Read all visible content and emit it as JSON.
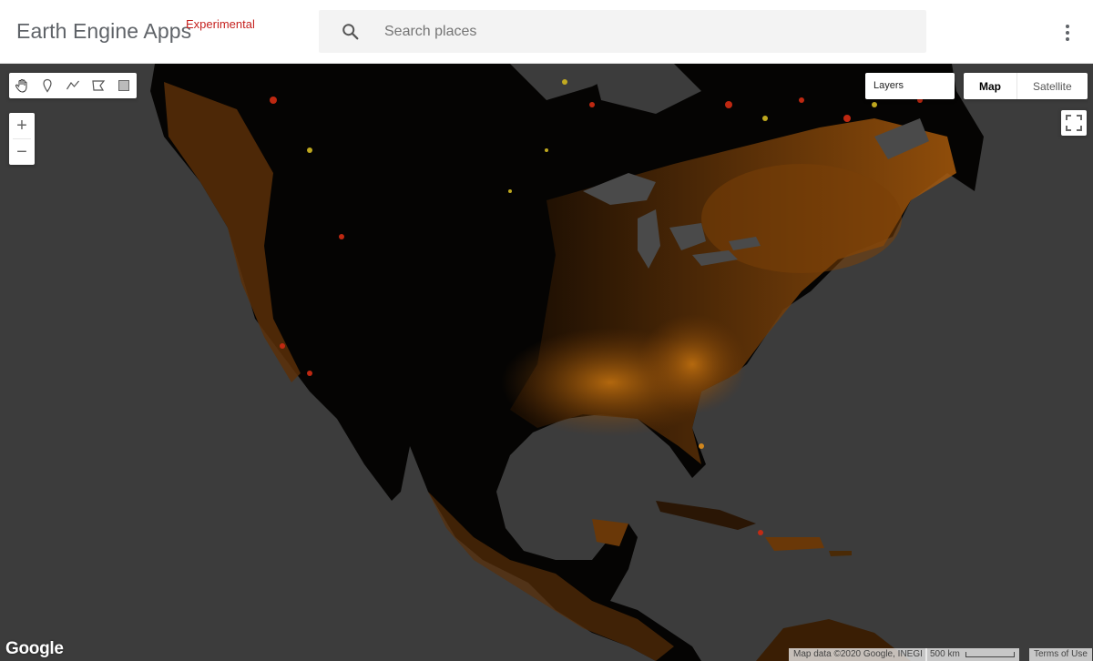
{
  "header": {
    "title": "Earth Engine Apps",
    "badge": "Experimental",
    "search_placeholder": "Search places",
    "icons": {
      "search": "search-icon",
      "menu": "more-vert-icon"
    }
  },
  "map": {
    "drawing_tools": [
      {
        "name": "pan-hand-icon"
      },
      {
        "name": "point-marker-icon"
      },
      {
        "name": "polyline-icon"
      },
      {
        "name": "polygon-icon"
      },
      {
        "name": "rectangle-icon"
      }
    ],
    "zoom_in_label": "+",
    "zoom_out_label": "−",
    "layers_label": "Layers",
    "map_types": [
      {
        "label": "Map",
        "active": true
      },
      {
        "label": "Satellite",
        "active": false
      }
    ],
    "fullscreen_icon": "fullscreen-icon",
    "logo": "Google",
    "attribution": "Map data ©2020 Google, INEGI",
    "scale_label": "500 km",
    "terms_label": "Terms of Use"
  },
  "colors": {
    "accent": "#c5221f",
    "map_background": "#3c3c3c",
    "land": "#050403",
    "heat_dark": "#5a2f08",
    "heat_mid": "#b0620f",
    "heat_light": "#d88a1c",
    "heat_yellow": "#c8b020",
    "heat_red": "#c82a12"
  }
}
